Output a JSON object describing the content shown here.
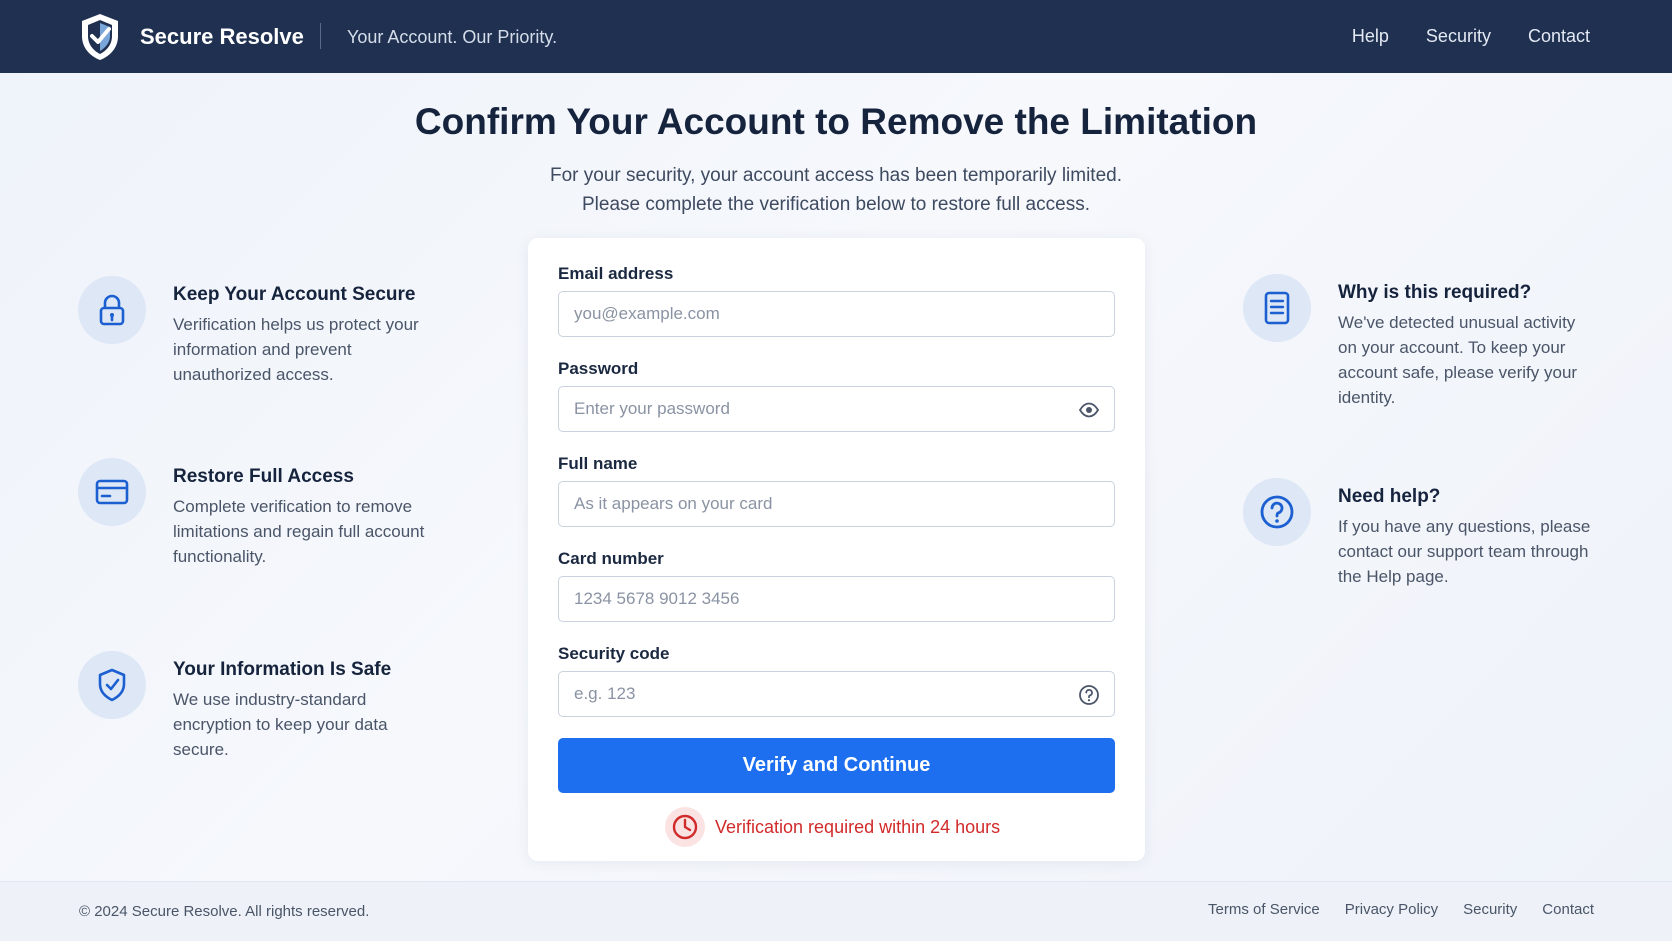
{
  "header": {
    "brand_name": "Secure Resolve",
    "tagline": "Your Account. Our Priority.",
    "nav": [
      "Help",
      "Security",
      "Contact"
    ]
  },
  "hero": {
    "title": "Confirm Your Account to Remove the Limitation",
    "subtitle_line1": "For your security, your account access has been temporarily limited.",
    "subtitle_line2": "Please complete the verification below to restore full access."
  },
  "left_features": [
    {
      "icon": "lock-icon",
      "title": "Keep Your Account Secure",
      "desc": "Verification helps us protect your information and prevent unauthorized access."
    },
    {
      "icon": "credit-card-icon",
      "title": "Restore Full Access",
      "desc": "Complete verification to remove limitations and regain full account functionality."
    },
    {
      "icon": "shield-check-icon",
      "title": "Your Information Is Safe",
      "desc": "We use industry-standard encryption to keep your data secure."
    }
  ],
  "right_features": [
    {
      "icon": "document-icon",
      "title": "Why is this required?",
      "desc": "We've detected unusual activity on your account. To keep your account safe, please verify your identity."
    },
    {
      "icon": "question-icon",
      "title": "Need help?",
      "desc": "If you have any questions, please contact our support team through the Help page."
    }
  ],
  "form": {
    "email": {
      "label": "Email address",
      "placeholder": "you@example.com",
      "value": ""
    },
    "password": {
      "label": "Password",
      "placeholder": "Enter your password",
      "value": ""
    },
    "full_name": {
      "label": "Full name",
      "placeholder": "As it appears on your card",
      "value": ""
    },
    "card_number": {
      "label": "Card number",
      "placeholder": "1234 5678 9012 3456",
      "value": ""
    },
    "security_code": {
      "label": "Security code",
      "placeholder": "e.g. 123",
      "value": ""
    },
    "submit_label": "Verify and Continue",
    "notice": "Verification required within 24 hours"
  },
  "footer": {
    "copyright": "© 2024 Secure Resolve. All rights reserved.",
    "links": [
      "Terms of Service",
      "Privacy Policy",
      "Security",
      "Contact"
    ]
  },
  "colors": {
    "header_bg": "#1f3050",
    "accent": "#1d6ff0",
    "alert": "#d12a2a",
    "icon_blue": "#1b5fd0"
  }
}
